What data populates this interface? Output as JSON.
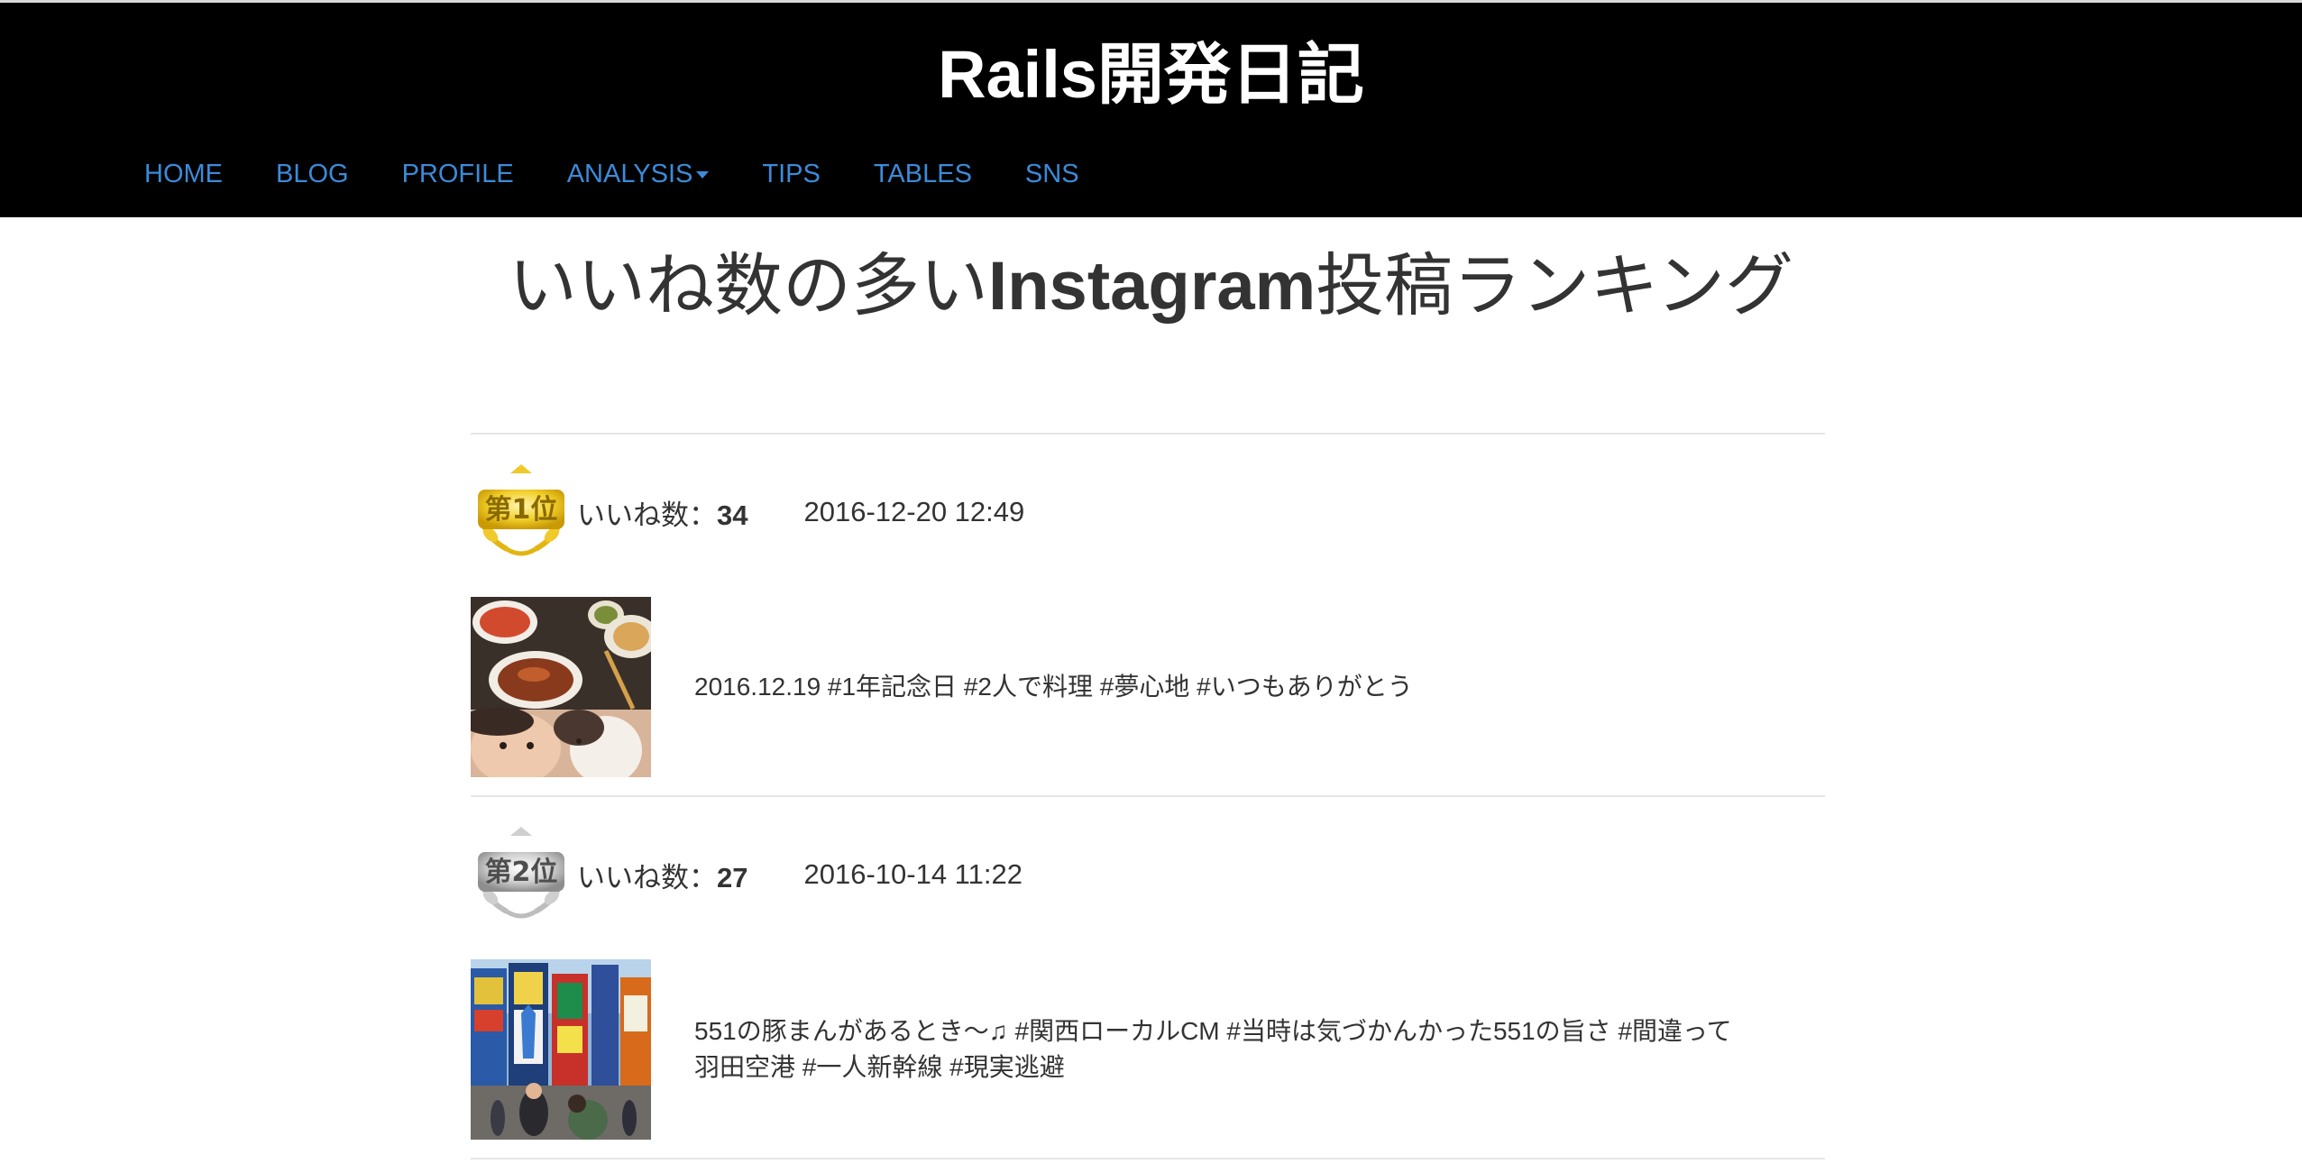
{
  "header": {
    "site_title": "Rails開発日記",
    "nav": [
      {
        "label": "HOME"
      },
      {
        "label": "BLOG"
      },
      {
        "label": "PROFILE"
      },
      {
        "label": "ANALYSIS",
        "has_dropdown": true
      },
      {
        "label": "TIPS"
      },
      {
        "label": "TABLES"
      },
      {
        "label": "SNS"
      }
    ]
  },
  "page": {
    "title_prefix": "いいね数の多い",
    "title_bold": "Instagram",
    "title_suffix": "投稿ランキング"
  },
  "posts": [
    {
      "rank_badge": "第1位",
      "likes_label": "いいね数：",
      "likes": "34",
      "datetime": "2016-12-20 12:49",
      "caption": "2016.12.19 #1年記念日 #2人で料理 #夢心地 #いつもありがとう",
      "thumb_icon": "food-photo-thumbnail"
    },
    {
      "rank_badge": "第2位",
      "likes_label": "いいね数：",
      "likes": "27",
      "datetime": "2016-10-14 11:22",
      "caption_line1": "551の豚まんがあるとき〜♫ #関西ローカルCM #当時は気づかんかった551の旨さ #間違って",
      "caption_line2": "羽田空港 #一人新幹線 #現実逃避",
      "thumb_icon": "city-photo-thumbnail"
    }
  ],
  "colors": {
    "header_bg": "#000000",
    "nav_link": "#3b8bd9",
    "gold": "#e8c21a",
    "silver": "#9a9a9a"
  }
}
